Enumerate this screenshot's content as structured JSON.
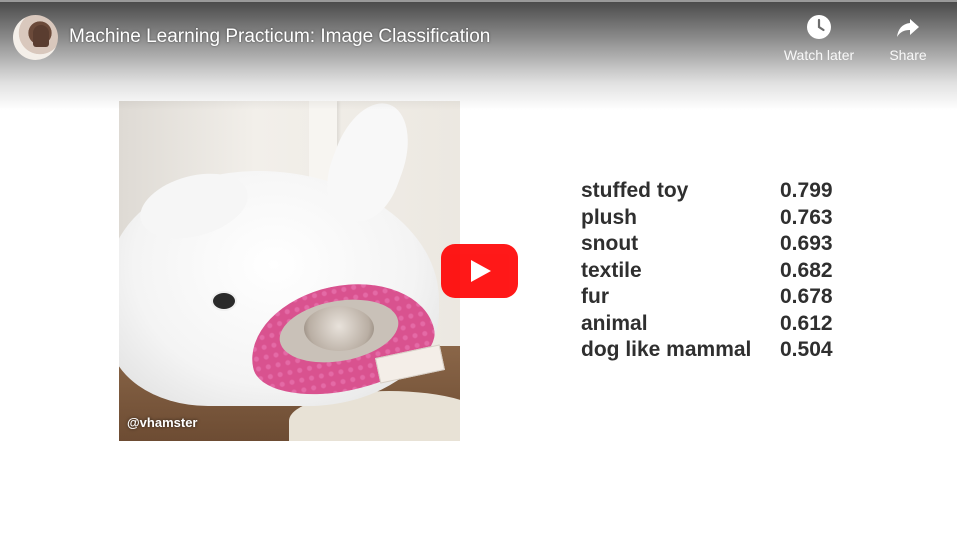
{
  "video": {
    "title": "Machine Learning Practicum: Image Classification",
    "watch_later_label": "Watch later",
    "share_label": "Share"
  },
  "photo": {
    "credit": "@vhamster"
  },
  "predictions": [
    {
      "label": "stuffed toy",
      "score": "0.799"
    },
    {
      "label": "plush",
      "score": "0.763"
    },
    {
      "label": "snout",
      "score": "0.693"
    },
    {
      "label": "textile",
      "score": "0.682"
    },
    {
      "label": "fur",
      "score": "0.678"
    },
    {
      "label": "animal",
      "score": "0.612"
    },
    {
      "label": "dog like mammal",
      "score": "0.504"
    }
  ],
  "colors": {
    "play_button": "#ff0000",
    "text": "#2f2f2f"
  },
  "icons": [
    "clock-icon",
    "share-arrow-icon",
    "play-icon"
  ]
}
